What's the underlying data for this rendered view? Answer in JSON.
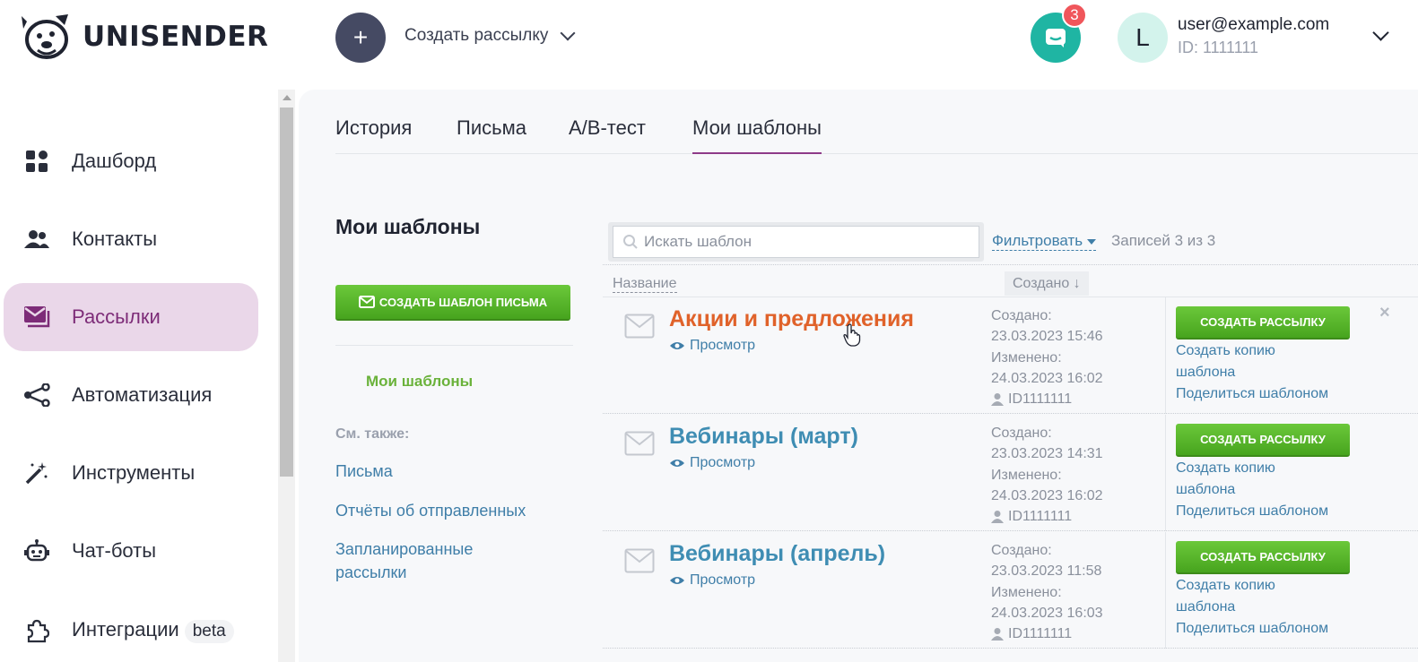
{
  "header": {
    "logo_text": "UNISENDER",
    "create_icon": "+",
    "create_label": "Создать рассылку",
    "chat_badge": "3",
    "avatar_letter": "L",
    "user_email": "user@example.com",
    "user_id": "ID: 1111111"
  },
  "sidebar": {
    "items": [
      {
        "label": "Дашборд",
        "icon": "dashboard-icon"
      },
      {
        "label": "Контакты",
        "icon": "contacts-icon"
      },
      {
        "label": "Рассылки",
        "icon": "mailings-icon",
        "active": true
      },
      {
        "label": "Автоматизация",
        "icon": "automation-icon"
      },
      {
        "label": "Инструменты",
        "icon": "magic-wand-icon"
      },
      {
        "label": "Чат-боты",
        "icon": "robot-icon"
      },
      {
        "label": "Интеграции",
        "icon": "puzzle-icon",
        "badge": "beta"
      }
    ]
  },
  "tabs": [
    "История",
    "Письма",
    "A/B-тест",
    "Мои шаблоны"
  ],
  "active_tab": "Мои шаблоны",
  "left": {
    "title": "Мои шаблоны",
    "create_button": "СОЗДАТЬ ШАБЛОН ПИСЬМА",
    "active_link": "Мои шаблоны",
    "see_also": "См. также:",
    "links": [
      "Письма",
      "Отчёты об отправленных",
      "Запланированные рассылки"
    ]
  },
  "list": {
    "search_placeholder": "Искать шаблон",
    "filter_label": "Фильтровать",
    "records": "Записей 3 из 3",
    "col_name": "Название",
    "col_created": "Создано ↓",
    "rows": [
      {
        "name": "Акции и предложения",
        "preview": "Просмотр",
        "created_label": "Создано:",
        "created": "23.03.2023 15:46",
        "modified_label": "Изменено:",
        "modified": "24.03.2023 16:02",
        "uid": "ID1111111",
        "create_btn": "СОЗДАТЬ РАССЫЛКУ",
        "copy_line1": "Создать копию",
        "copy_line2": "шаблона",
        "share": "Поделиться шаблоном",
        "close": "×"
      },
      {
        "name": "Вебинары (март)",
        "preview": "Просмотр",
        "created_label": "Создано:",
        "created": "23.03.2023 14:31",
        "modified_label": "Изменено:",
        "modified": "24.03.2023 16:02",
        "uid": "ID1111111",
        "create_btn": "СОЗДАТЬ РАССЫЛКУ",
        "copy_line1": "Создать копию",
        "copy_line2": "шаблона",
        "share": "Поделиться шаблоном"
      },
      {
        "name": "Вебинары (апрель)",
        "preview": "Просмотр",
        "created_label": "Создано:",
        "created": "23.03.2023 11:58",
        "modified_label": "Изменено:",
        "modified": "24.03.2023 16:03",
        "uid": "ID1111111",
        "create_btn": "СОЗДАТЬ РАССЫЛКУ",
        "copy_line1": "Создать копию",
        "copy_line2": "шаблона",
        "share": "Поделиться шаблоном"
      }
    ]
  },
  "colors": {
    "accent_purple": "#7d2c78",
    "active_nav_bg": "#ead7e9",
    "green": "#56b32a",
    "link": "#3f7ea8",
    "hover_title": "#e0622a",
    "teal": "#1fb5a3",
    "badge_red": "#f0565b"
  }
}
